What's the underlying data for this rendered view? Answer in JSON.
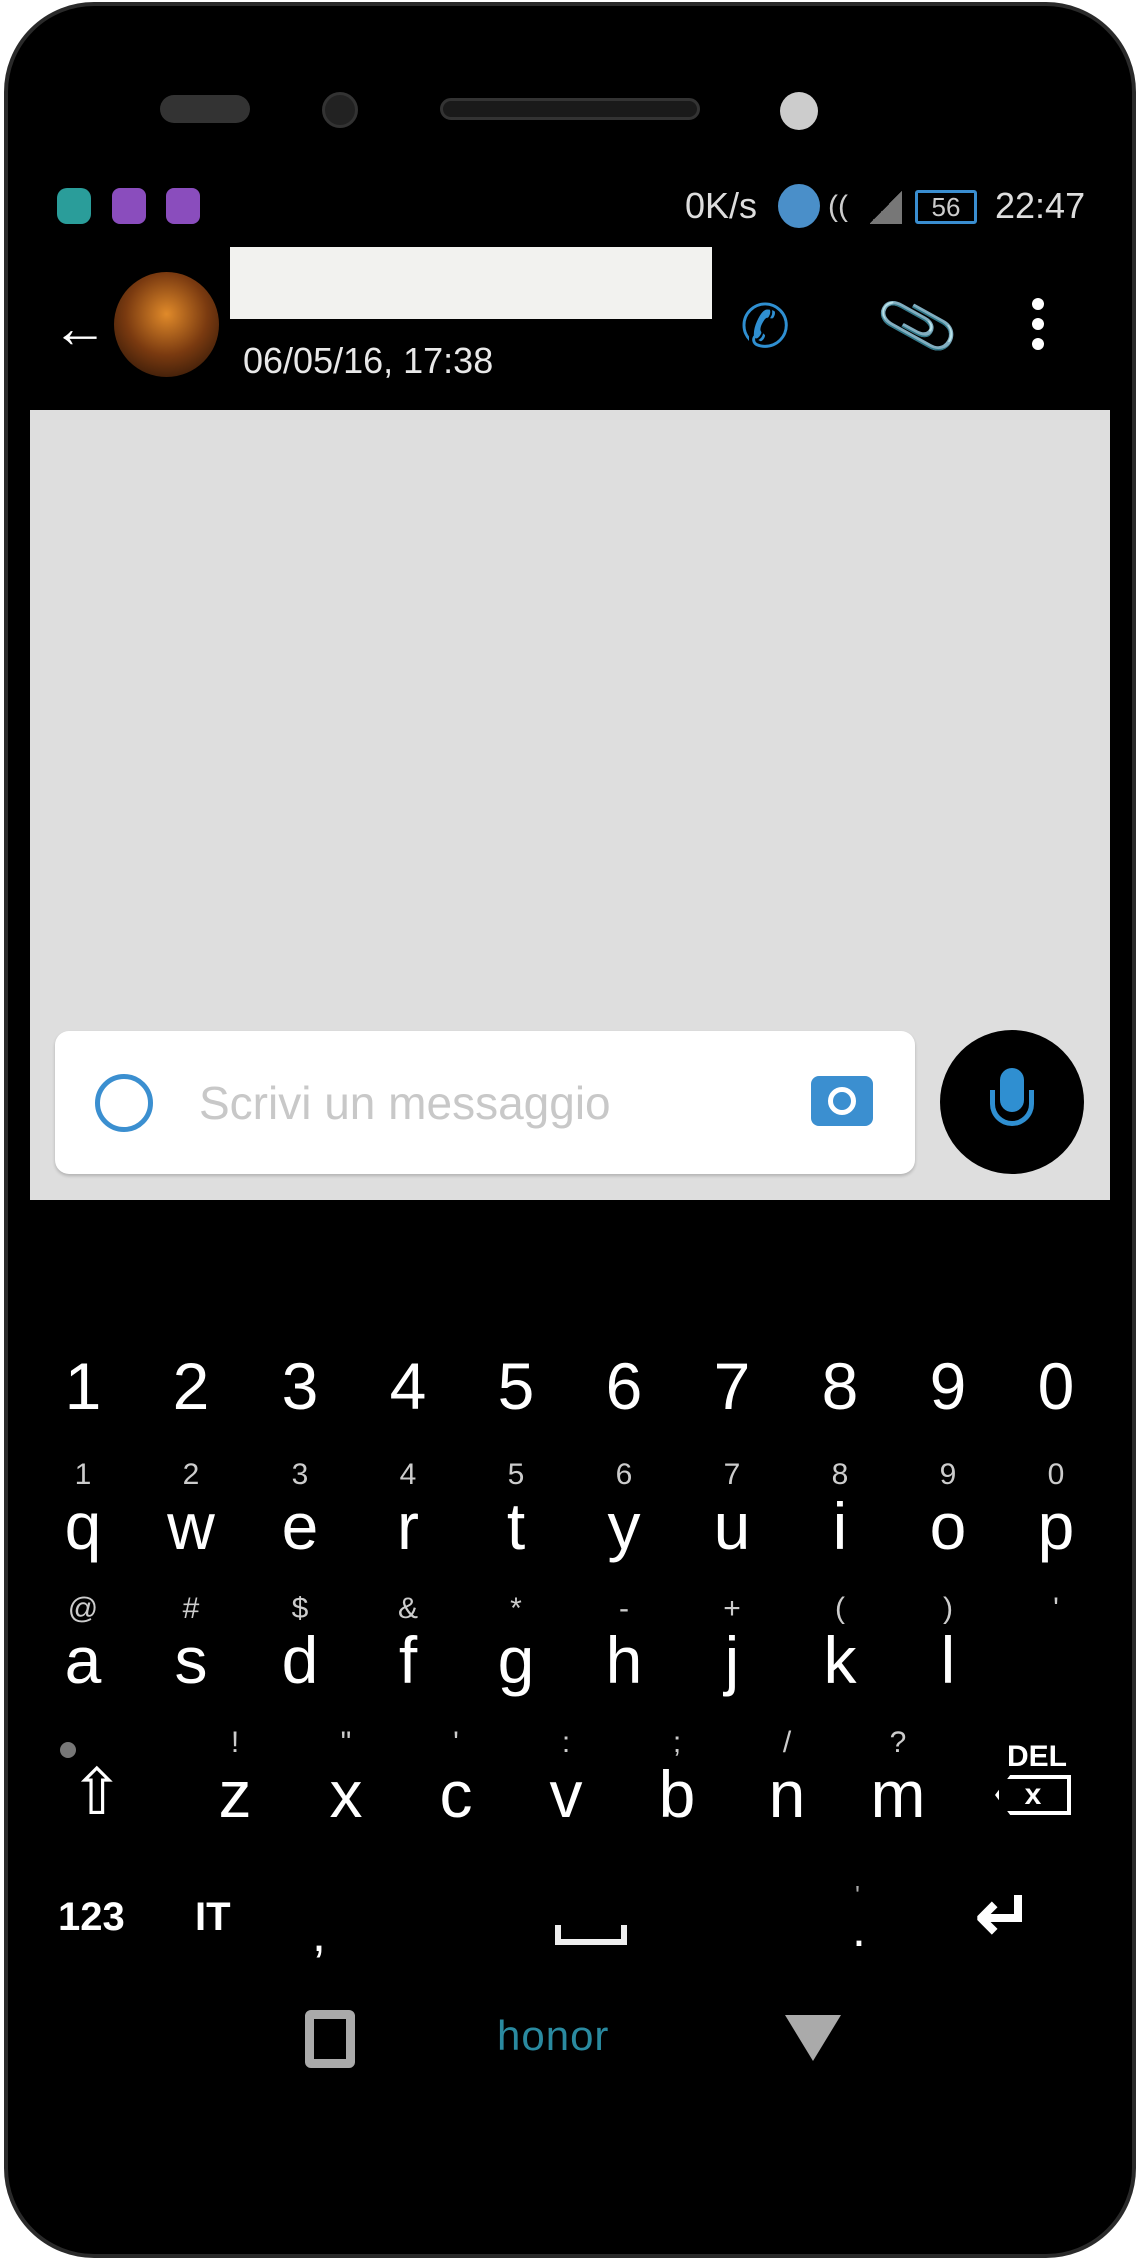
{
  "status_bar": {
    "speed": "0K/s",
    "battery": "56",
    "time": "22:47",
    "left_icons": [
      "moon-icon",
      "keyboard-icon",
      "image-icon"
    ],
    "right_icons": [
      "alarm-icon",
      "nfc-icon",
      "signal-icon",
      "battery-icon"
    ]
  },
  "header": {
    "subtitle": "06/05/16, 17:38",
    "accent": "#2f8fd1"
  },
  "composer": {
    "placeholder": "Scrivi un messaggio"
  },
  "keyboard": {
    "numbers": [
      "1",
      "2",
      "3",
      "4",
      "5",
      "6",
      "7",
      "8",
      "9",
      "0"
    ],
    "row1": [
      "q",
      "w",
      "e",
      "r",
      "t",
      "y",
      "u",
      "i",
      "o",
      "p"
    ],
    "row1_hints": [
      "1",
      "2",
      "3",
      "4",
      "5",
      "6",
      "7",
      "8",
      "9",
      "0"
    ],
    "row2": [
      "a",
      "s",
      "d",
      "f",
      "g",
      "h",
      "j",
      "k",
      "l"
    ],
    "row2_hints": [
      "@",
      "#",
      "$",
      "&",
      "*",
      "-",
      "+",
      "(",
      ")",
      "'"
    ],
    "row3": [
      "z",
      "x",
      "c",
      "v",
      "b",
      "n",
      "m"
    ],
    "row3_hints": [
      "!",
      "\"",
      "'",
      ":",
      ";",
      "/",
      "?"
    ],
    "del_label": "DEL",
    "symbols_label": "123",
    "lang_label": "IT",
    "comma": ",",
    "period": ".",
    "period_hint": "'"
  },
  "nav": {
    "brand": "honor"
  }
}
